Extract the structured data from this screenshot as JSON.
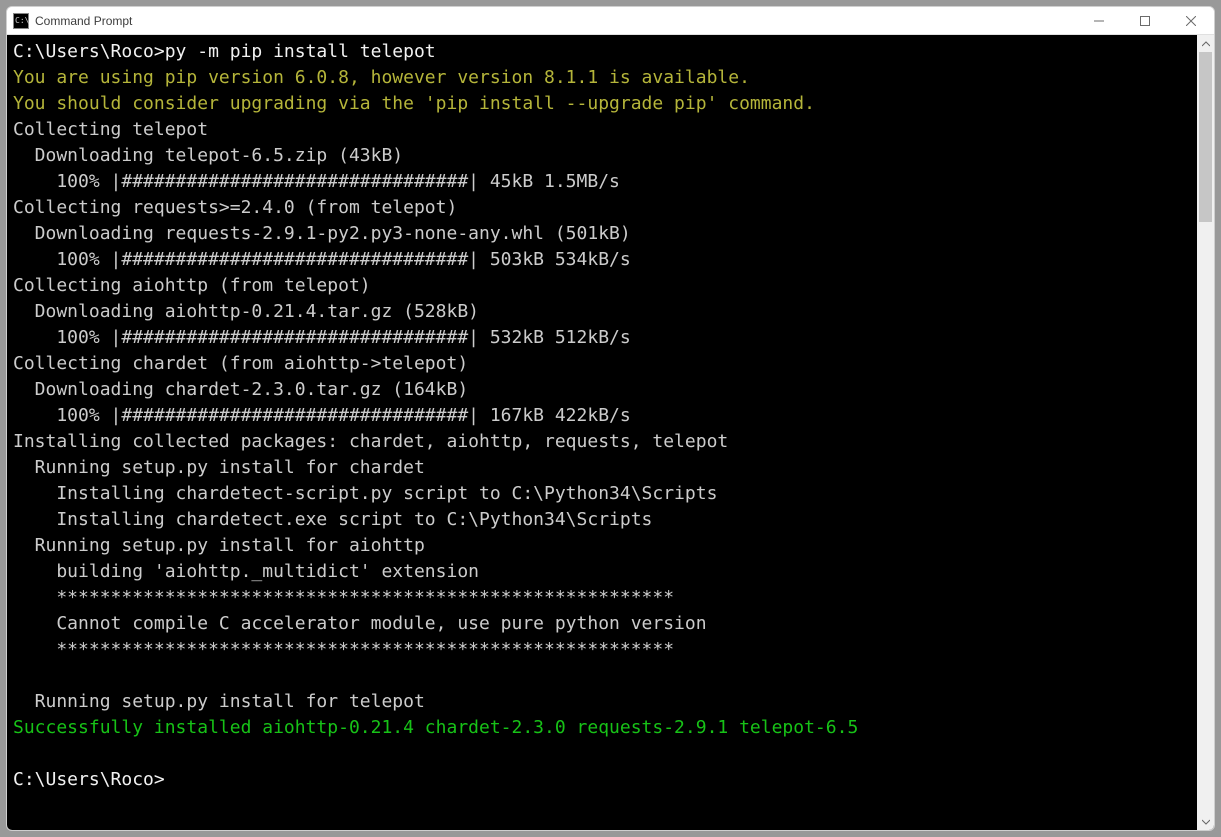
{
  "window": {
    "title": "Command Prompt"
  },
  "prompt1_path": "C:\\Users\\Roco>",
  "prompt1_cmd": "py -m pip install telepot",
  "warn_line1": "You are using pip version 6.0.8, however version 8.1.1 is available.",
  "warn_line2": "You should consider upgrading via the 'pip install --upgrade pip' command.",
  "l1": "Collecting telepot",
  "l2": "  Downloading telepot-6.5.zip (43kB)",
  "l3": "    100% |################################| 45kB 1.5MB/s",
  "l4": "Collecting requests>=2.4.0 (from telepot)",
  "l5": "  Downloading requests-2.9.1-py2.py3-none-any.whl (501kB)",
  "l6": "    100% |################################| 503kB 534kB/s",
  "l7": "Collecting aiohttp (from telepot)",
  "l8": "  Downloading aiohttp-0.21.4.tar.gz (528kB)",
  "l9": "    100% |################################| 532kB 512kB/s",
  "l10": "Collecting chardet (from aiohttp->telepot)",
  "l11": "  Downloading chardet-2.3.0.tar.gz (164kB)",
  "l12": "    100% |################################| 167kB 422kB/s",
  "l13": "Installing collected packages: chardet, aiohttp, requests, telepot",
  "l14": "  Running setup.py install for chardet",
  "l15": "    Installing chardetect-script.py script to C:\\Python34\\Scripts",
  "l16": "    Installing chardetect.exe script to C:\\Python34\\Scripts",
  "l17": "  Running setup.py install for aiohttp",
  "l18": "    building 'aiohttp._multidict' extension",
  "l19": "    *********************************************************",
  "l20": "    Cannot compile C accelerator module, use pure python version",
  "l21": "    *********************************************************",
  "l22": "",
  "l23": "  Running setup.py install for telepot",
  "l24": "Successfully installed aiohttp-0.21.4 chardet-2.3.0 requests-2.9.1 telepot-6.5",
  "l25": "",
  "prompt2_path": "C:\\Users\\Roco>"
}
